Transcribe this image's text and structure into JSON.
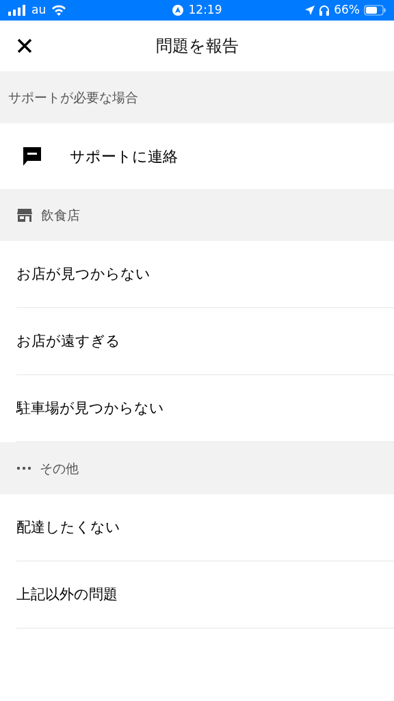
{
  "status_bar": {
    "carrier": "au",
    "time": "12:19",
    "battery": "66%"
  },
  "header": {
    "title": "問題を報告"
  },
  "sections": [
    {
      "kind": "plain",
      "title": "サポートが必要な場合",
      "items": [
        {
          "kind": "support",
          "label": "サポートに連絡"
        }
      ]
    },
    {
      "kind": "store",
      "title": "飲食店",
      "items": [
        {
          "kind": "plain",
          "label": "お店が見つからない"
        },
        {
          "kind": "plain",
          "label": "お店が遠すぎる"
        },
        {
          "kind": "plain",
          "label": "駐車場が見つからない"
        }
      ]
    },
    {
      "kind": "more",
      "title": "その他",
      "items": [
        {
          "kind": "plain",
          "label": "配達したくない"
        },
        {
          "kind": "plain",
          "label": "上記以外の問題"
        }
      ]
    }
  ]
}
